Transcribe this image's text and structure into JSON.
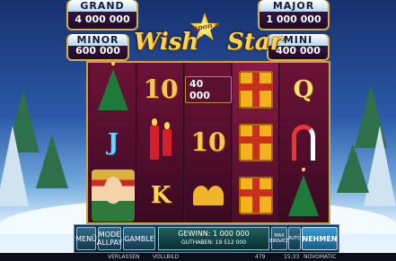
{
  "jackpots": {
    "grand": {
      "label": "GRAND",
      "value": "4 000 000"
    },
    "major": {
      "label": "MAJOR",
      "value": "1 000 000"
    },
    "minor": {
      "label": "MINOR",
      "value": "600 000"
    },
    "mini": {
      "label": "MINI",
      "value": "400 000"
    }
  },
  "logo": {
    "word1": "Wish",
    "word2": "upon a",
    "word3": "Star"
  },
  "reels": [
    {
      "symbols": [
        {
          "type": "tree"
        },
        {
          "type": "letter",
          "text": "J"
        },
        {
          "type": "elf"
        }
      ]
    },
    {
      "symbols": [
        {
          "type": "number",
          "text": "10"
        },
        {
          "type": "candles"
        },
        {
          "type": "letter",
          "text": "K"
        }
      ]
    },
    {
      "symbols": [
        {
          "type": "value",
          "text": "40 000"
        },
        {
          "type": "number",
          "text": "10"
        },
        {
          "type": "bells"
        }
      ]
    },
    {
      "symbols": [
        {
          "type": "gift"
        },
        {
          "type": "gift"
        },
        {
          "type": "gift"
        }
      ]
    },
    {
      "symbols": [
        {
          "type": "letter",
          "text": "Q"
        },
        {
          "type": "cane"
        },
        {
          "type": "tree"
        }
      ]
    }
  ],
  "controls": {
    "menu": "MENÜ",
    "mode_line1": "MODE",
    "mode_line2": "ALLPAY",
    "gamble": "GAMBLE",
    "win_label": "GEWINN:",
    "win_value": "1 000 000",
    "balance_label": "GUTHABEN:",
    "balance_value": "19 512 000",
    "max_bet_line1": "MAX",
    "max_bet_line2": "EINSATZ",
    "auto": "AUTO",
    "start": "NEHMEN"
  },
  "status": {
    "left": "VERLASSEN",
    "volume": "VOLLBILD",
    "bet": "479",
    "time": "15:33",
    "brand": "NOVOMATIC"
  },
  "colors": {
    "gold": "#d7b04a",
    "reel_bg": "#4a0f2e",
    "button": "#2e6c86"
  }
}
